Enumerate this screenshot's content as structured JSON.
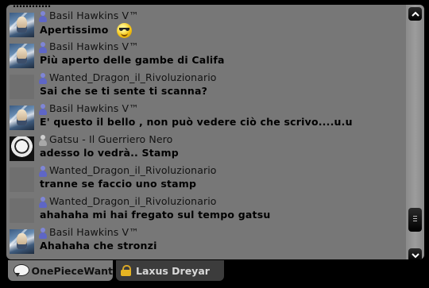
{
  "chat": {
    "top_partial_text": "…………",
    "messages": [
      {
        "user": "Basil Hawkins V™",
        "avatar": "basil",
        "role": "blue",
        "text": "Apertissimo",
        "emoji": "sunglasses-smiley"
      },
      {
        "user": "Basil Hawkins V™",
        "avatar": "basil",
        "role": "blue",
        "text": "Più aperto delle gambe di Califa"
      },
      {
        "user": "Wanted_Dragon_il_Rivoluzionario",
        "avatar": "blank",
        "role": "blue",
        "text": "Sai che se ti sente ti scanna?"
      },
      {
        "user": "Basil Hawkins V™",
        "avatar": "basil",
        "role": "blue",
        "text": "E' questo il bello , non può vedere ciò che scrivo....u.u"
      },
      {
        "user": "Gatsu - Il Guerriero Nero",
        "avatar": "gatsu",
        "role": "grey",
        "text": "adesso lo vedrà.. Stamp"
      },
      {
        "user": "Wanted_Dragon_il_Rivoluzionario",
        "avatar": "blank",
        "role": "blue",
        "text": "tranne se faccio uno stamp"
      },
      {
        "user": "Wanted_Dragon_il_Rivoluzionario",
        "avatar": "blank",
        "role": "blue",
        "text": "ahahaha mi hai fregato sul tempo gatsu"
      },
      {
        "user": "Basil Hawkins V™",
        "avatar": "basil",
        "role": "blue",
        "text": "Ahahaha che stronzi"
      }
    ]
  },
  "tabs": [
    {
      "label": "OnePieceWant",
      "icon": "chat-bubble-icon",
      "active": true
    },
    {
      "label": "Laxus Dreyar",
      "icon": "lock-icon",
      "active": false
    }
  ],
  "scroll": {
    "position_fraction": 0.93
  }
}
